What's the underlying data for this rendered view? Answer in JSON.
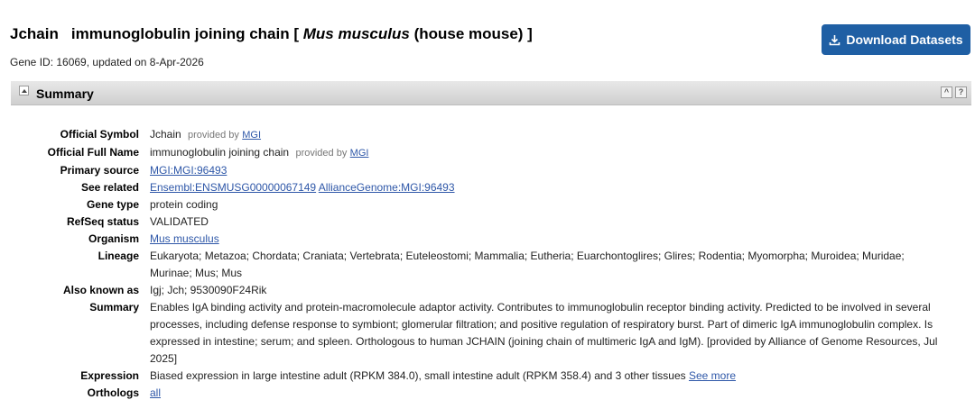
{
  "header": {
    "symbol": "Jchain",
    "name_prefix": "immunoglobulin joining chain [",
    "organism_italic": "Mus musculus",
    "name_suffix": "(house mouse) ]",
    "gene_id_line": "Gene ID: 16069, updated on 8-Apr-2026",
    "download_label": "Download Datasets"
  },
  "summary_section": {
    "title": "Summary"
  },
  "rows": {
    "official_symbol": {
      "label": "Official Symbol",
      "value": "Jchain",
      "provided_by": "provided by",
      "provider": "MGI"
    },
    "official_full_name": {
      "label": "Official Full Name",
      "value": "immunoglobulin joining chain",
      "provided_by": "provided by",
      "provider": "MGI"
    },
    "primary_source": {
      "label": "Primary source",
      "link": "MGI:MGI:96493"
    },
    "see_related": {
      "label": "See related",
      "link1": "Ensembl:ENSMUSG00000067149",
      "link2": "AllianceGenome:MGI:96493"
    },
    "gene_type": {
      "label": "Gene type",
      "value": "protein coding"
    },
    "refseq_status": {
      "label": "RefSeq status",
      "value": "VALIDATED"
    },
    "organism": {
      "label": "Organism",
      "link": "Mus musculus"
    },
    "lineage": {
      "label": "Lineage",
      "value": "Eukaryota; Metazoa; Chordata; Craniata; Vertebrata; Euteleostomi; Mammalia; Eutheria; Euarchontoglires; Glires; Rodentia; Myomorpha; Muroidea; Muridae; Murinae; Mus; Mus"
    },
    "also_known_as": {
      "label": "Also known as",
      "value": "Igj; Jch; 9530090F24Rik"
    },
    "summary": {
      "label": "Summary",
      "value": "Enables IgA binding activity and protein-macromolecule adaptor activity. Contributes to immunoglobulin receptor binding activity. Predicted to be involved in several processes, including defense response to symbiont; glomerular filtration; and positive regulation of respiratory burst. Part of dimeric IgA immunoglobulin complex. Is expressed in intestine; serum; and spleen. Orthologous to human JCHAIN (joining chain of multimeric IgA and IgM). [provided by Alliance of Genome Resources, Jul 2025]"
    },
    "expression": {
      "label": "Expression",
      "value": "Biased expression in large intestine adult (RPKM 384.0), small intestine adult (RPKM 358.4) and 3 other tissues",
      "link": "See more"
    },
    "orthologs": {
      "label": "Orthologs",
      "link": "all"
    }
  }
}
